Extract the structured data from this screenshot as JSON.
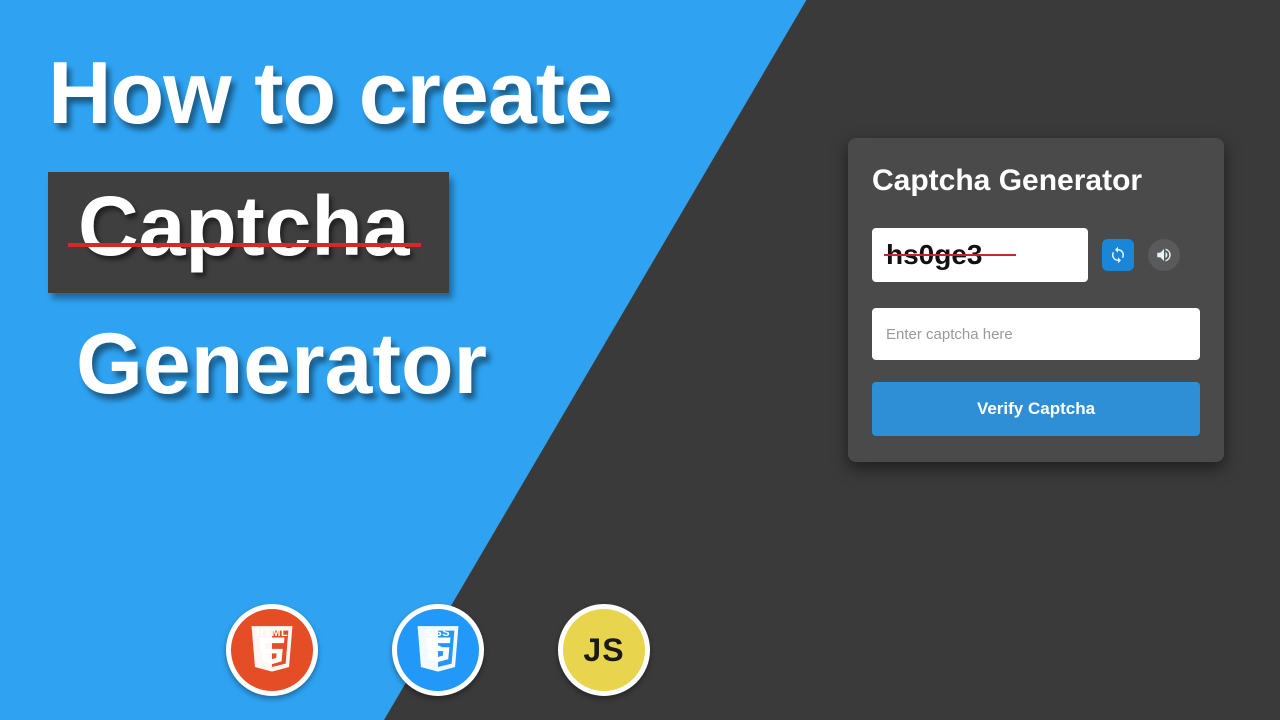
{
  "hero": {
    "line1": "How to create",
    "boxed_word": "Captcha",
    "line3": "Generator"
  },
  "badges": {
    "html_label": "HTML",
    "css_label": "CSS",
    "js_label": "JS"
  },
  "widget": {
    "title": "Captcha Generator",
    "captcha_value": "hs0ge3",
    "input_placeholder": "Enter captcha here",
    "verify_label": "Verify Captcha"
  },
  "colors": {
    "bg_blue": "#2fa3f2",
    "dark": "#3a3a3a",
    "accent": "#2e8fd6",
    "strike_red": "#d9262a"
  }
}
